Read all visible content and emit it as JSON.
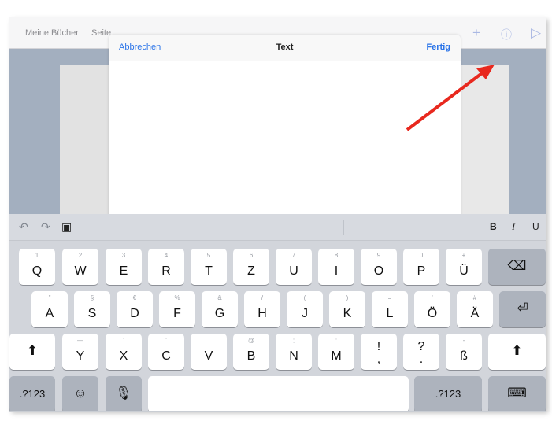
{
  "app_nav": {
    "my_books": "Meine Bücher",
    "pages": "Seite",
    "add_icon": "plus-icon",
    "info_icon": "info-icon",
    "play_icon": "play-icon"
  },
  "modal": {
    "cancel_label": "Abbrechen",
    "title": "Text",
    "done_label": "Fertig",
    "text_value": ""
  },
  "suggestion_bar": {
    "undo_icon": "undo-icon",
    "redo_icon": "redo-icon",
    "paste_icon": "paste-icon",
    "bold": "B",
    "italic": "I",
    "underline": "U"
  },
  "keyboard": {
    "row1": [
      {
        "main": "Q",
        "sub": "1"
      },
      {
        "main": "W",
        "sub": "2"
      },
      {
        "main": "E",
        "sub": "3"
      },
      {
        "main": "R",
        "sub": "4"
      },
      {
        "main": "T",
        "sub": "5"
      },
      {
        "main": "Z",
        "sub": "6"
      },
      {
        "main": "U",
        "sub": "7"
      },
      {
        "main": "I",
        "sub": "8"
      },
      {
        "main": "O",
        "sub": "9"
      },
      {
        "main": "P",
        "sub": "0"
      },
      {
        "main": "Ü",
        "sub": "+"
      }
    ],
    "row2": [
      {
        "main": "A",
        "sub": "\""
      },
      {
        "main": "S",
        "sub": "§"
      },
      {
        "main": "D",
        "sub": "€"
      },
      {
        "main": "F",
        "sub": "%"
      },
      {
        "main": "G",
        "sub": "&"
      },
      {
        "main": "H",
        "sub": "/"
      },
      {
        "main": "J",
        "sub": "("
      },
      {
        "main": "K",
        "sub": ")"
      },
      {
        "main": "L",
        "sub": "="
      },
      {
        "main": "Ö",
        "sub": "'"
      },
      {
        "main": "Ä",
        "sub": "#"
      }
    ],
    "row3": [
      {
        "main": "Y",
        "sub": "—"
      },
      {
        "main": "X",
        "sub": "'"
      },
      {
        "main": "C",
        "sub": "'"
      },
      {
        "main": "V",
        "sub": "…"
      },
      {
        "main": "B",
        "sub": "@"
      },
      {
        "main": "N",
        "sub": ";"
      },
      {
        "main": "M",
        "sub": ":"
      },
      {
        "main": "!",
        "sub": ""
      },
      {
        "main": "?",
        "sub": ""
      },
      {
        "main": "ß",
        "sub": "-"
      }
    ],
    "row3_extra": {
      "excl_bottom": ",",
      "question_bottom": "."
    },
    "numbers_left": ".?123",
    "numbers_right": ".?123",
    "shift_icon": "shift-icon",
    "delete_icon": "delete-icon",
    "return_icon": "return-icon",
    "emoji_icon": "emoji-icon",
    "mic_icon": "microphone-icon",
    "hide_keyboard_icon": "keyboard-hide-icon"
  },
  "annotation": {
    "arrow_color": "#e8281e"
  }
}
